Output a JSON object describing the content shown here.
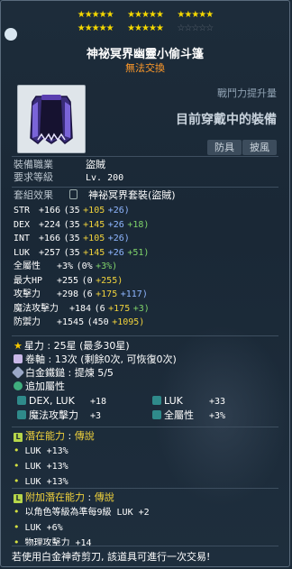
{
  "header": {
    "title": "神祕冥界幽靈小偷斗篷",
    "subtitle": "無法交換"
  },
  "stars": {
    "count": "25",
    "glyph": "★"
  },
  "power_label": "戰鬥力提升量",
  "equipped_label": "目前穿戴中的裝備",
  "tags": [
    "防具",
    "披風"
  ],
  "basic": [
    {
      "label": "裝備職業",
      "value": "盜賊"
    },
    {
      "label": "要求等級",
      "value": "Lv. 200"
    }
  ],
  "set": {
    "label": "套組效果",
    "value": "神祕冥界套裝(盜賊)"
  },
  "stats": [
    {
      "name": "STR",
      "base": "+166",
      "open": "(35",
      "a": "+105",
      "b": "+26)",
      "ac": "y",
      "bc": "b"
    },
    {
      "name": "DEX",
      "base": "+224",
      "open": "(35",
      "a": "+145",
      "b": "+26",
      "c": "+18)",
      "ac": "y",
      "bc": "b"
    },
    {
      "name": "INT",
      "base": "+166",
      "open": "(35",
      "a": "+105",
      "b": "+26)",
      "ac": "y",
      "bc": "b"
    },
    {
      "name": "LUK",
      "base": "+257",
      "open": "(35",
      "a": "+145",
      "b": "+26",
      "c": "+51)",
      "ac": "y",
      "bc": "b"
    },
    {
      "name": "全屬性",
      "base": "+3%",
      "open": "(0%",
      "a": "+3%)",
      "ac": "g"
    },
    {
      "name": "最大HP",
      "base": "+255",
      "open": "(0",
      "a": "+255)",
      "ac": "y"
    },
    {
      "name": "攻擊力",
      "base": "+298",
      "open": "(6",
      "a": "+175",
      "b": "+117)",
      "ac": "y",
      "bc": "b"
    },
    {
      "name": "魔法攻擊力",
      "base": "+184",
      "open": "(6",
      "a": "+175",
      "b": "+3)",
      "ac": "y",
      "bc": "g"
    },
    {
      "name": "防禦力",
      "base": "+1545",
      "open": "(450",
      "a": "+1095)",
      "ac": "y"
    }
  ],
  "upgrade": {
    "star_label": "星力",
    "star_value": "25星 (最多30星)",
    "scroll_label": "卷軸",
    "scroll_value": "13次 (剩餘0次, 可恢復0次)",
    "hammer_label": "白金鐵鎚",
    "hammer_value": "提煉 5/5",
    "extra_label": "追加屬性",
    "extra": [
      [
        "DEX, LUK",
        "+18",
        "LUK",
        "+33"
      ],
      [
        "魔法攻擊力",
        "+3",
        "全屬性",
        "+3%"
      ]
    ]
  },
  "potential": {
    "badge": "L",
    "label": "潛在能力",
    "grade": "傳說",
    "lines": [
      "LUK +13%",
      "LUK +13%",
      "LUK +13%"
    ]
  },
  "additional": {
    "badge": "L",
    "label": "附加潛在能力",
    "grade": "傳說",
    "lines": [
      "以角色等級為準每9級 LUK +2",
      "LUK +6%",
      "物理攻擊力 +14"
    ]
  },
  "footer": "若使用白金神奇剪刀, 該道具可進行一次交易!"
}
